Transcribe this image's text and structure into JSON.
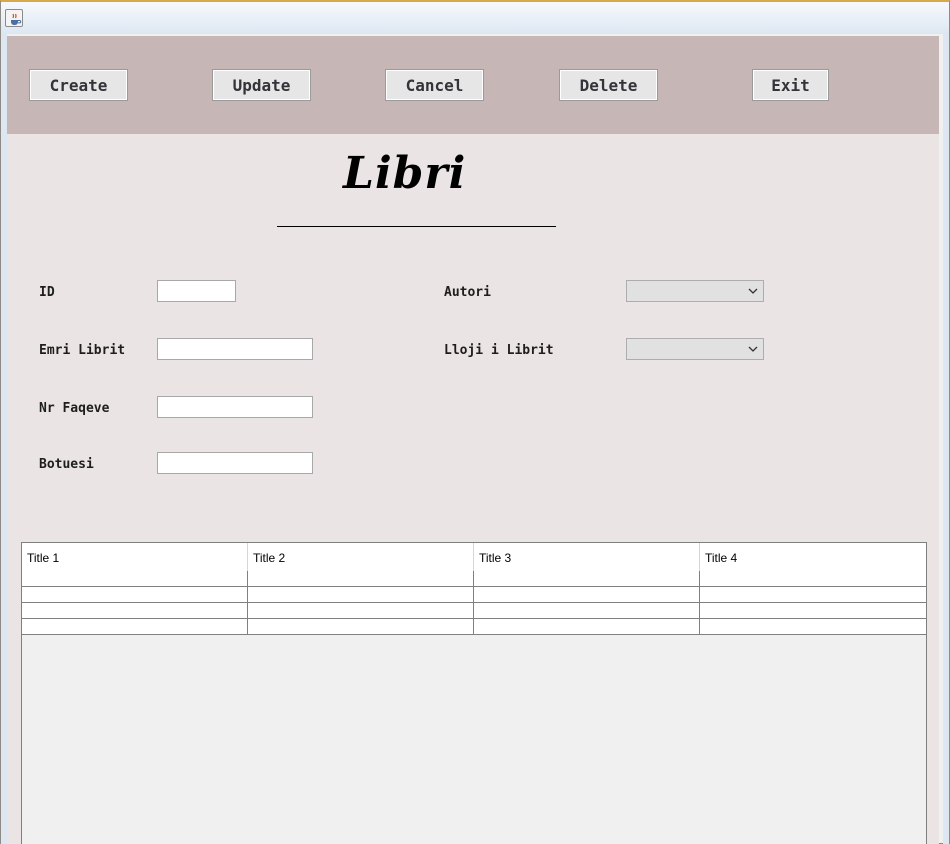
{
  "window": {
    "icon": "java-cup-icon"
  },
  "toolbar": {
    "buttons": [
      {
        "label": "Create"
      },
      {
        "label": "Update"
      },
      {
        "label": "Cancel"
      },
      {
        "label": "Delete"
      },
      {
        "label": "Exit"
      }
    ]
  },
  "form": {
    "title": "Libri",
    "id_label": "ID",
    "id_value": "",
    "name_label": "Emri Librit",
    "name_value": "",
    "pages_label": "Nr Faqeve",
    "pages_value": "",
    "publisher_label": "Botuesi",
    "publisher_value": "",
    "author_label": "Autori",
    "author_selected": "",
    "type_label": "Lloji i Librit",
    "type_selected": ""
  },
  "table": {
    "columns": [
      "Title 1",
      "Title 2",
      "Title 3",
      "Title 4"
    ],
    "rows": [
      [
        "",
        "",
        "",
        ""
      ],
      [
        "",
        "",
        "",
        ""
      ],
      [
        "",
        "",
        "",
        ""
      ],
      [
        "",
        "",
        "",
        ""
      ]
    ]
  }
}
